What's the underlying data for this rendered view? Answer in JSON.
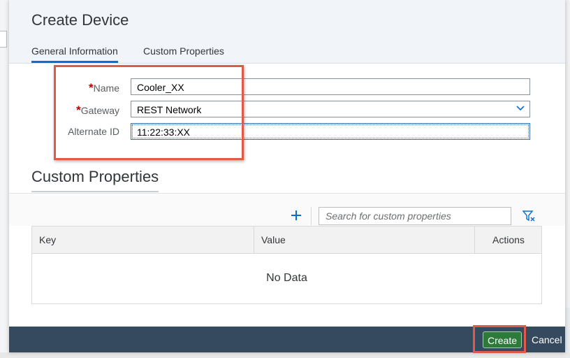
{
  "dialog": {
    "title": "Create Device",
    "tabs": [
      {
        "label": "General Information",
        "active": true
      },
      {
        "label": "Custom Properties",
        "active": false
      }
    ]
  },
  "form": {
    "name": {
      "label": "Name",
      "required": true,
      "value": "Cooler_XX"
    },
    "gateway": {
      "label": "Gateway",
      "required": true,
      "value": "REST Network"
    },
    "alternate_id": {
      "label": "Alternate ID",
      "required": false,
      "value": "11:22:33:XX"
    },
    "required_marker": "*"
  },
  "custom_properties": {
    "title": "Custom Properties",
    "search_placeholder": "Search for custom properties",
    "add_icon": "plus-icon",
    "filter_icon": "filter-clear-icon",
    "columns": [
      "Key",
      "Value",
      "Actions"
    ],
    "empty_text": "No Data"
  },
  "footer": {
    "create_label": "Create",
    "cancel_label": "Cancel"
  },
  "colors": {
    "accent": "#0a6ed1",
    "highlight": "#e05a4a",
    "footer_bg": "#354a5f",
    "create_bg": "#2d7a3a"
  }
}
